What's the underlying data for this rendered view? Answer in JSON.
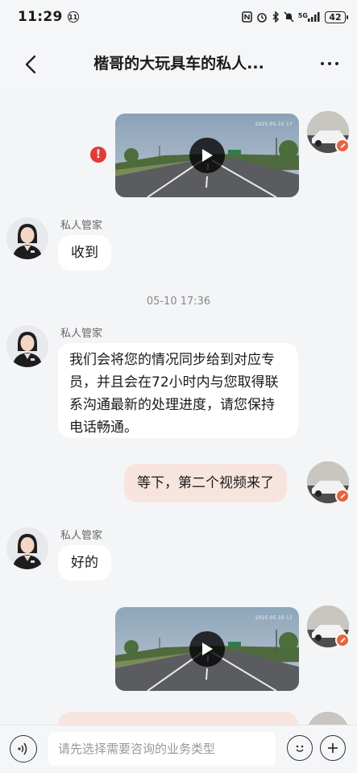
{
  "status_bar": {
    "time": "11:29",
    "badge": "11",
    "network": "5G",
    "battery": "42"
  },
  "header": {
    "title": "楷哥的大玩具车的私人..."
  },
  "messages": {
    "agent_name": "私人管家",
    "msg2_text": "收到",
    "timestamp": "05-10 17:36",
    "msg3_text": "我们会将您的情况同步给到对应专员，并且会在72小时内与您取得联系沟通最新的处理进度，请您保持电话畅通。",
    "msg4_text": "等下，第二个视频来了",
    "msg5_text": "好的",
    "video_stamp": "2025.05.10 17"
  },
  "input": {
    "placeholder": "请先选择需要咨询的业务类型"
  },
  "colors": {
    "user_bubble": "#f8e4df",
    "agent_bubble": "#ffffff",
    "error": "#e53935",
    "background": "#f4f5f7"
  },
  "icons": {
    "back": "chevron-left-icon",
    "more": "more-dots-icon",
    "voice": "voice-icon",
    "emoji": "emoji-icon",
    "plus": "plus-icon",
    "play": "play-icon",
    "error": "error-icon"
  }
}
